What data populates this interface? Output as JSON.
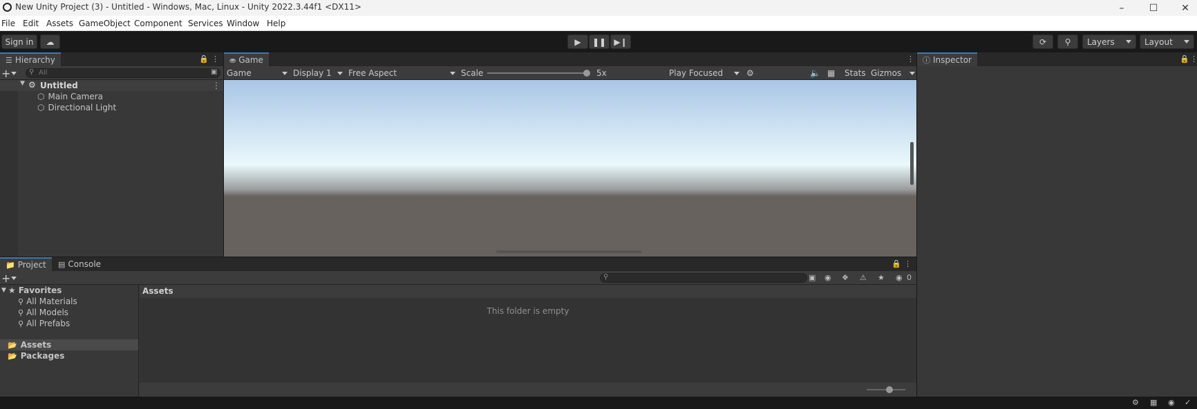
{
  "window": {
    "title": "New Unity Project (3) - Untitled - Windows, Mac, Linux - Unity 2022.3.44f1 <DX11>",
    "controls": [
      "minimize-icon",
      "maximize-icon",
      "close-icon"
    ]
  },
  "menu": [
    "File",
    "Edit",
    "Assets",
    "GameObject",
    "Component",
    "Services",
    "Window",
    "Help"
  ],
  "toolbar": {
    "sign_in": "Sign in",
    "layers": "Layers",
    "layout": "Layout"
  },
  "hierarchy": {
    "tab": "Hierarchy",
    "search_placeholder": "All",
    "scene": "Untitled",
    "items": [
      "Main Camera",
      "Directional Light"
    ]
  },
  "game": {
    "tab": "Game",
    "mode": "Game",
    "display": "Display 1",
    "aspect": "Free Aspect",
    "scale_label": "Scale",
    "scale_value": "5x",
    "play_mode": "Play Focused",
    "stats": "Stats",
    "gizmos": "Gizmos",
    "colors": {
      "sky_top": "#a9c6e6",
      "horizon": "#eaf8fb",
      "ground": "#68625e"
    }
  },
  "inspector": {
    "tab": "Inspector"
  },
  "project": {
    "tabs": [
      "Project",
      "Console"
    ],
    "favorites_label": "Favorites",
    "favorites": [
      "All Materials",
      "All Models",
      "All Prefabs"
    ],
    "roots": [
      "Assets",
      "Packages"
    ],
    "breadcrumb": "Assets",
    "empty_message": "This folder is empty",
    "hidden_count": "0"
  }
}
